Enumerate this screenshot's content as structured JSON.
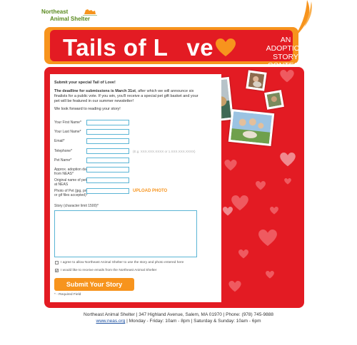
{
  "logo": {
    "line1": "Northeast",
    "line2": "Animal Shelter"
  },
  "banner": {
    "title_part1": "Tails of L",
    "title_part2": "ve",
    "subtitle_line1": "AN ADOPTION",
    "subtitle_line2": "STORY CONTEST"
  },
  "form": {
    "heading": "Submit your special Tail of Love!",
    "deadline_bold": "The deadline for submissions is March 31st",
    "deadline_rest": ", after which we will announce six finalists for a public vote. If you win, you'll receive a special pet gift basket and your pet will be featured in our summer newsletter!",
    "look_forward": "We look forward to reading your story!",
    "fields": [
      {
        "label": "Your First Name*",
        "hint": ""
      },
      {
        "label": "Your Last Name*",
        "hint": ""
      },
      {
        "label": "Email*",
        "hint": ""
      },
      {
        "label": "Telephone*",
        "hint": "(E.g. XXX.XXX.XXXX or 1.XXX.XXX.XXXX)"
      },
      {
        "label": "Pet Name*",
        "hint": ""
      },
      {
        "label": "Approx. adoption date from NEAS*",
        "hint": ""
      },
      {
        "label": "Original name of pet at NEAS",
        "hint": ""
      },
      {
        "label": "Photo of Pet (jpg, png, or gif files accepted)*",
        "hint": ""
      }
    ],
    "upload_label": "UPLOAD PHOTO",
    "story_label": "Story (character limit 1500)*",
    "checkbox1_label": "I agree to allow Northeast Animal Shelter to use the story and photo entered here",
    "checkbox2_label": "I would like to receive emails from the Northeast Animal Shelter",
    "checkbox1_checked": false,
    "checkbox2_checked": true,
    "submit_label": "Submit Your Story",
    "required_note": "* - Required Field"
  },
  "footer": {
    "line1": "Northeast Animal Shelter | 347 Highland Avenue, Salem, MA 01970 | Phone: (978) 745-9888",
    "link": "www.neas.org",
    "line2_rest": " | Monday - Friday: 10am - 8pm | Saturday & Sunday: 10am - 6pm"
  },
  "colors": {
    "red": "#e31b23",
    "orange": "#f7941d",
    "green": "#5a8a1f",
    "input_border": "#5bb5d5"
  }
}
